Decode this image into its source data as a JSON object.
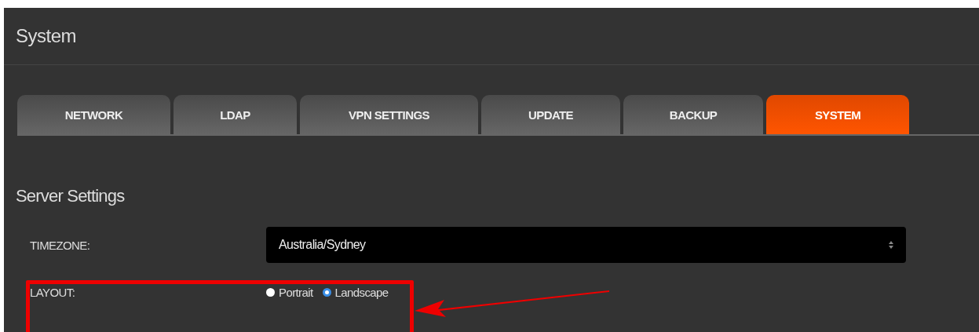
{
  "header": {
    "title": "System"
  },
  "tabs": [
    {
      "label": "NETWORK",
      "selected": false
    },
    {
      "label": "LDAP",
      "selected": false
    },
    {
      "label": "VPN SETTINGS",
      "selected": false
    },
    {
      "label": "UPDATE",
      "selected": false
    },
    {
      "label": "BACKUP",
      "selected": false
    },
    {
      "label": "SYSTEM",
      "selected": true
    }
  ],
  "section": {
    "title": "Server Settings"
  },
  "timezone": {
    "label": "TIMEZONE:",
    "value": "Australia/Sydney"
  },
  "layout": {
    "label": "LAYOUT:",
    "options": [
      {
        "label": "Portrait",
        "selected": false
      },
      {
        "label": "Landscape",
        "selected": true
      }
    ]
  }
}
